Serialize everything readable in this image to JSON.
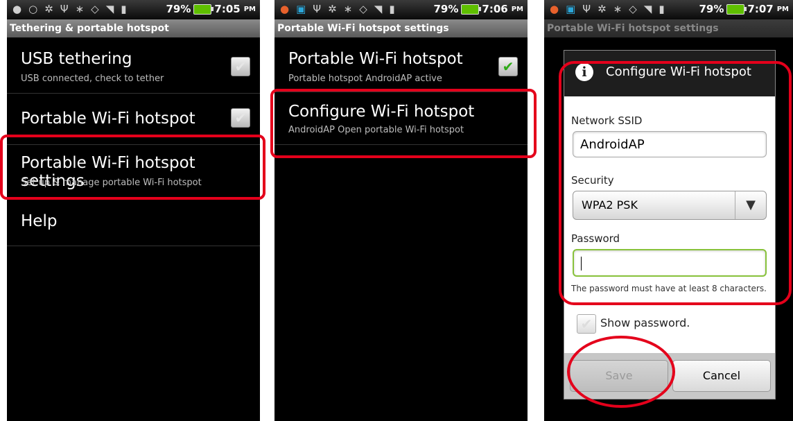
{
  "status": [
    {
      "battery": "79%",
      "time": "7:05",
      "ampm": "PM"
    },
    {
      "battery": "79%",
      "time": "7:06",
      "ampm": "PM"
    },
    {
      "battery": "79%",
      "time": "7:07",
      "ampm": "PM"
    }
  ],
  "screen1": {
    "title": "Tethering & portable hotspot",
    "items": [
      {
        "title": "USB tethering",
        "subtitle": "USB connected, check to tether"
      },
      {
        "title": "Portable Wi-Fi hotspot"
      },
      {
        "title": "Portable Wi-Fi hotspot settings",
        "subtitle": "Set up & manage portable Wi-Fi hotspot"
      },
      {
        "title": "Help"
      }
    ]
  },
  "screen2": {
    "title": "Portable Wi-Fi hotspot settings",
    "items": [
      {
        "title": "Portable Wi-Fi hotspot",
        "subtitle": "Portable hotspot AndroidAP active"
      },
      {
        "title": "Configure Wi-Fi hotspot",
        "subtitle": "AndroidAP Open portable Wi-Fi hotspot"
      }
    ]
  },
  "screen3": {
    "title": "Portable Wi-Fi hotspot settings",
    "dialog": {
      "title": "Configure Wi-Fi hotspot",
      "ssid_label": "Network SSID",
      "ssid_value": "AndroidAP",
      "security_label": "Security",
      "security_value": "WPA2 PSK",
      "password_label": "Password",
      "password_value": "",
      "hint": "The password must have at least 8 characters.",
      "show_password": "Show password.",
      "save": "Save",
      "cancel": "Cancel"
    }
  },
  "colors": {
    "highlight": "#e4001b",
    "check_green": "#2eaa17",
    "focus_green": "#88c23b"
  }
}
